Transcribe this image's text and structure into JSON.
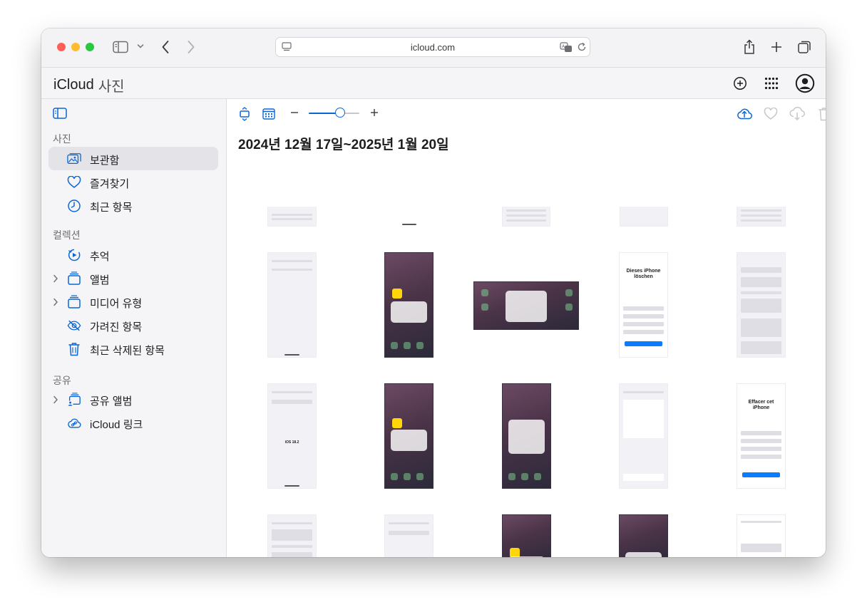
{
  "browser": {
    "url": "icloud.com"
  },
  "app": {
    "brand": "iCloud",
    "section": "사진"
  },
  "sidebar": {
    "sections": [
      {
        "title": "사진",
        "items": [
          {
            "label": "보관함",
            "icon": "photo-library-icon",
            "active": true
          },
          {
            "label": "즐겨찾기",
            "icon": "heart-icon"
          },
          {
            "label": "최근 항목",
            "icon": "clock-icon"
          }
        ]
      },
      {
        "title": "컬렉션",
        "items": [
          {
            "label": "추억",
            "icon": "memories-icon"
          },
          {
            "label": "앨범",
            "icon": "album-stack-icon",
            "expandable": true
          },
          {
            "label": "미디어 유형",
            "icon": "media-types-icon",
            "expandable": true
          },
          {
            "label": "가려진 항목",
            "icon": "eye-slash-icon"
          },
          {
            "label": "최근 삭제된 항목",
            "icon": "trash-icon"
          }
        ]
      },
      {
        "title": "공유",
        "items": [
          {
            "label": "공유 앨범",
            "icon": "shared-album-icon",
            "expandable": true
          },
          {
            "label": "iCloud 링크",
            "icon": "link-cloud-icon"
          }
        ]
      }
    ]
  },
  "main": {
    "date_range": "2024년 12월 17일~2025년 1월 20일",
    "zoom_level": 0.62
  },
  "thumbnails": {
    "t_dieses": "Dieses iPhone löschen",
    "t_effacer": "Effacer cet iPhone",
    "t_ios": "iOS 18.2"
  },
  "colors": {
    "accent": "#0a66d6",
    "sidebar_bg": "#f5f5f7",
    "active_item_bg": "#e3e3e8"
  }
}
